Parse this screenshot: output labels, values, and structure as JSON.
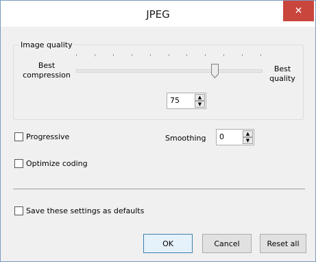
{
  "window": {
    "title": "JPEG",
    "close_icon": "close-icon"
  },
  "image_quality": {
    "group_label": "Image quality",
    "left_label": "Best\ncompression",
    "right_label": "Best\nquality",
    "slider_value_percent": 75,
    "tick_count": 11,
    "value": "75",
    "spin_up_icon": "up-arrow-icon",
    "spin_down_icon": "down-arrow-icon"
  },
  "options": {
    "progressive_label": "Progressive",
    "progressive_checked": false,
    "optimize_label": "Optimize coding",
    "optimize_checked": false,
    "smoothing_label": "Smoothing",
    "smoothing_value": "0"
  },
  "defaults": {
    "label": "Save these settings as defaults",
    "checked": false
  },
  "buttons": {
    "ok": "OK",
    "cancel": "Cancel",
    "reset": "Reset all"
  },
  "colors": {
    "close_button": "#c9463d",
    "window_bg": "#f0f0f0",
    "title_bg": "#ffffff"
  }
}
